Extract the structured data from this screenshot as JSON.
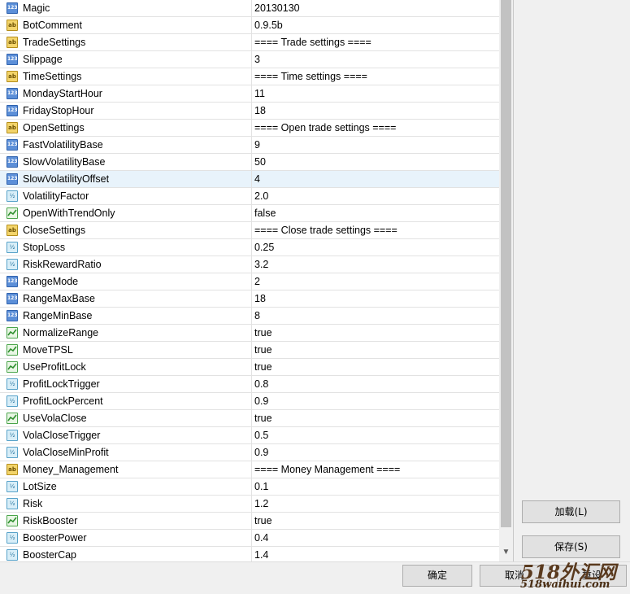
{
  "params": [
    {
      "name": "Magic",
      "value": "20130130",
      "type": "int"
    },
    {
      "name": "BotComment",
      "value": "0.9.5b",
      "type": "string"
    },
    {
      "name": "TradeSettings",
      "value": "==== Trade settings ====",
      "type": "string"
    },
    {
      "name": "Slippage",
      "value": "3",
      "type": "int"
    },
    {
      "name": "TimeSettings",
      "value": "==== Time settings ====",
      "type": "string"
    },
    {
      "name": "MondayStartHour",
      "value": "11",
      "type": "int"
    },
    {
      "name": "FridayStopHour",
      "value": "18",
      "type": "int"
    },
    {
      "name": "OpenSettings",
      "value": "==== Open trade settings ====",
      "type": "string"
    },
    {
      "name": "FastVolatilityBase",
      "value": "9",
      "type": "int"
    },
    {
      "name": "SlowVolatilityBase",
      "value": "50",
      "type": "int"
    },
    {
      "name": "SlowVolatilityOffset",
      "value": "4",
      "type": "int",
      "selected": true
    },
    {
      "name": "VolatilityFactor",
      "value": "2.0",
      "type": "double"
    },
    {
      "name": "OpenWithTrendOnly",
      "value": "false",
      "type": "bool"
    },
    {
      "name": "CloseSettings",
      "value": "==== Close trade settings ====",
      "type": "string"
    },
    {
      "name": "StopLoss",
      "value": "0.25",
      "type": "double"
    },
    {
      "name": "RiskRewardRatio",
      "value": "3.2",
      "type": "double"
    },
    {
      "name": "RangeMode",
      "value": "2",
      "type": "int"
    },
    {
      "name": "RangeMaxBase",
      "value": "18",
      "type": "int"
    },
    {
      "name": "RangeMinBase",
      "value": "8",
      "type": "int"
    },
    {
      "name": "NormalizeRange",
      "value": "true",
      "type": "bool"
    },
    {
      "name": "MoveTPSL",
      "value": "true",
      "type": "bool"
    },
    {
      "name": "UseProfitLock",
      "value": "true",
      "type": "bool"
    },
    {
      "name": "ProfitLockTrigger",
      "value": "0.8",
      "type": "double"
    },
    {
      "name": "ProfitLockPercent",
      "value": "0.9",
      "type": "double"
    },
    {
      "name": "UseVolaClose",
      "value": "true",
      "type": "bool"
    },
    {
      "name": "VolaCloseTrigger",
      "value": "0.5",
      "type": "double"
    },
    {
      "name": "VolaCloseMinProfit",
      "value": "0.9",
      "type": "double"
    },
    {
      "name": "Money_Management",
      "value": "==== Money Management ====",
      "type": "string"
    },
    {
      "name": "LotSize",
      "value": "0.1",
      "type": "double"
    },
    {
      "name": "Risk",
      "value": "1.2",
      "type": "double"
    },
    {
      "name": "RiskBooster",
      "value": "true",
      "type": "bool"
    },
    {
      "name": "BoosterPower",
      "value": "0.4",
      "type": "double"
    },
    {
      "name": "BoosterCap",
      "value": "1.4",
      "type": "double"
    }
  ],
  "icon_glyphs": {
    "int": "123",
    "string": "ab",
    "double": "½",
    "bool": ""
  },
  "buttons": {
    "load": "加载(L)",
    "save": "保存(S)",
    "ok": "确定",
    "cancel": "取消",
    "reset": "重设"
  },
  "watermark": {
    "top": "518外汇网",
    "bottom": "518waihui.com"
  }
}
